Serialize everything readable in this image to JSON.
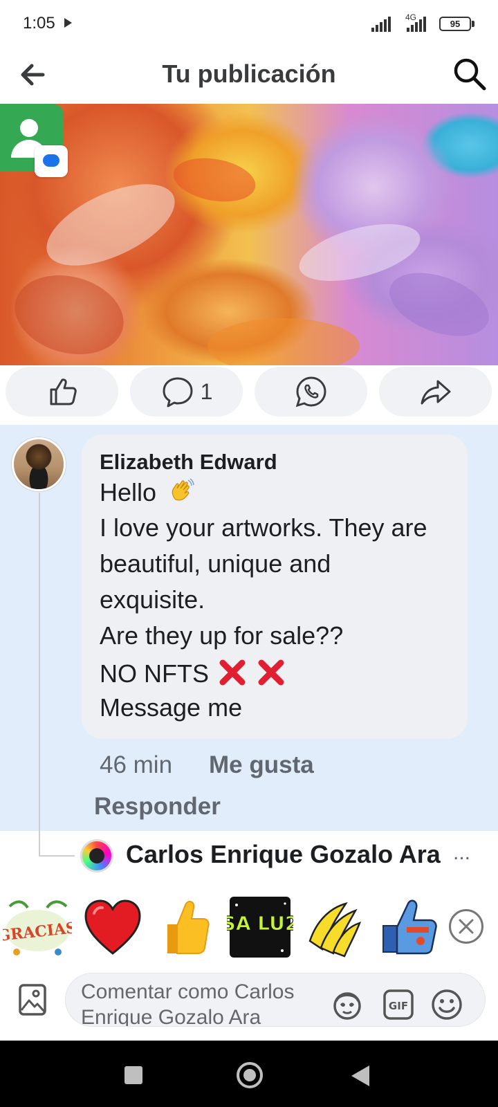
{
  "status_bar": {
    "time": "1:05",
    "network": "4G",
    "battery": "95"
  },
  "header": {
    "title": "Tu publicación",
    "back_icon": "arrow-left-icon",
    "search_icon": "search-icon"
  },
  "post": {
    "image_description_icon": "artwork-image",
    "badge_icon": "contacts-messages-icon"
  },
  "actions": {
    "like_icon": "thumbs-up-icon",
    "comment_icon": "comment-icon",
    "comment_count": "1",
    "whatsapp_icon": "whatsapp-icon",
    "share_icon": "share-icon"
  },
  "comment": {
    "author": "Elizabeth Edward",
    "lines": [
      "Hello",
      "I love your artworks. They are",
      "beautiful, unique and",
      "exquisite.",
      "Are they up for sale??",
      "NO NFTS",
      "Message me"
    ],
    "time": "46 min",
    "like_label": "Me gusta",
    "reply_label": "Responder"
  },
  "reply_preview": {
    "name": "Carlos Enrique Gozalo Ara",
    "more": "..."
  },
  "stickers": {
    "gracias": "GRACIAS",
    "saludos": "SA LU2",
    "items": [
      "gracias-sticker",
      "heart-sticker",
      "thumbs-up-sticker",
      "saludos-sticker",
      "bananas-sticker",
      "robot-thumbs-up-sticker"
    ]
  },
  "composer": {
    "placeholder": "Comentar como Carlos Enrique Gozalo Ara",
    "gif_label": "GIF"
  },
  "colors": {
    "comment_background": "#e2edfb",
    "bubble_background": "#eef0f3",
    "pill_background": "#f0f2f5",
    "meta_text": "#606770"
  }
}
